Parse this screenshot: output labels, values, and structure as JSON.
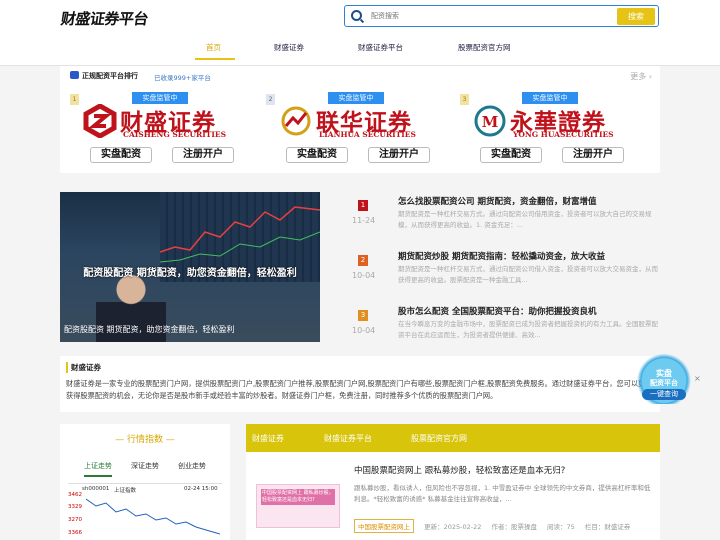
{
  "header": {
    "logo": "财盛证券平台",
    "search_placeholder": "配资搜索",
    "search_button": "搜索"
  },
  "nav": [
    "首页",
    "财盛证券",
    "财盛证券平台",
    "股票配资官方网"
  ],
  "rank": {
    "title": "正规配资平台排行",
    "subtitle": "已收录999+家平台",
    "more": "更多",
    "cards": [
      {
        "num": "1",
        "tag": "实盘监管中",
        "brand": "财盛证券",
        "eng": "CAISHENG SECURITIES",
        "btn1": "实盘配资",
        "btn2": "注册开户"
      },
      {
        "num": "2",
        "tag": "实盘监管中",
        "brand": "联华证券",
        "eng": "LIANHUA SECURITIES",
        "btn1": "实盘配资",
        "btn2": "注册开户"
      },
      {
        "num": "3",
        "tag": "实盘监管中",
        "brand": "永華證券",
        "eng": "YONG HUASECURITIES",
        "btn1": "实盘配资",
        "btn2": "注册开户"
      }
    ]
  },
  "banner": {
    "headline": "配资股配资 期货配资，助您资金翻倍，轻松盈利",
    "caption": "配资股配资 期货配资，助您资金翻倍，轻松盈利"
  },
  "news": [
    {
      "rank": "1",
      "date": "11-24",
      "title": "怎么找股票配资公司 期货配资，资金翻倍，财富增值",
      "desc": "期货配资是一种杠杆交易方式。通过向配资公司借用资金，投资者可以放大自己的交易规模，从而获得更高的收益。1. 资金充足：..."
    },
    {
      "rank": "2",
      "date": "10-04",
      "title": "期货配资炒股 期货配资指南：轻松撬动资金，放大收益",
      "desc": "期货配资是一种杠杆交易方式，通过向配资公司借入资金，投资者可以放大交易资金，从而获得更高的收益。股票配资是一种金融工具..."
    },
    {
      "rank": "3",
      "date": "10-04",
      "title": "股市怎么配资 全国股票配资平台：助你把握投资良机",
      "desc": "在当今瞬息万变的金融市场中，股票配资已成为投资者把握投资机的有力工具。全国股票配资平台在此应运而生，为投资者提供便捷、高效..."
    }
  ],
  "about": {
    "heading": "财盛证券",
    "text": "财盛证券是一家专业的股票配资门户网，提供股票配资门户,股票配资门户推荐,股票配资门户网,股票配资门户有哪些,股票配资门户框,股票配资免费服务。通过财盛证券平台，您可以更多获得股票配资的机会，无论你是否是股市新手或经验丰富的炒股者。财盛证券门户框，免费注册，同时推荐多个优质的股票配资门户网。"
  },
  "float_ad": {
    "line1": "实盘",
    "line2": "配资平台",
    "line3": "一键查询",
    "close": "×"
  },
  "market": {
    "heading": "行情指数",
    "tabs": [
      "上证走势",
      "深证走势",
      "创业走势"
    ],
    "chart_code": "sh000001",
    "chart_name": "上证指数",
    "chart_time": "02-24 15:00",
    "y_ticks": [
      "3462",
      "3329",
      "3270",
      "3366"
    ]
  },
  "articles": {
    "tabs": [
      "财盛证券",
      "财盛证券平台",
      "股票配资官方网"
    ],
    "item": {
      "title": "中国股票配资网上 跟私募炒股，轻松致富还是血本无归?",
      "desc": "跟私募炒股，看似诱人，但风险也不容忽视，1. 中雪盈证券中 全球领先的中文券商，提供高杠杆率和低利息。*轻松致富的诱惑* 私募基金往往宣称高收益，...",
      "thumb_caption": "中国股票配资网上 跟私募炒股，轻松致富还是血本无归?",
      "tag": "中国股票配资网上",
      "updated": "更新：2025-02-22",
      "author": "作者：股票操盘",
      "reads": "阅读：75",
      "column": "栏目：财盛证券"
    }
  },
  "colors": {
    "accent": "#e6c416",
    "brand_red": "#c0121b",
    "link_blue": "#2f7fd8"
  }
}
